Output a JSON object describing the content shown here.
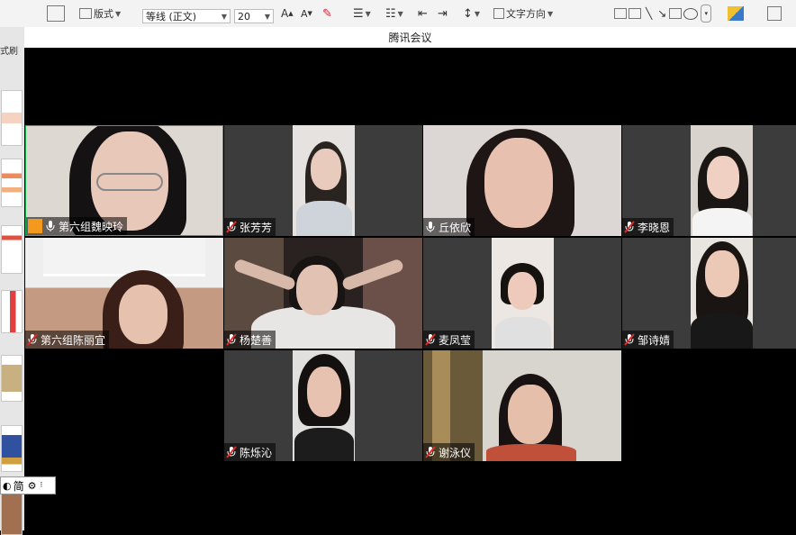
{
  "ribbon": {
    "layout_label": "版式",
    "font_name": "等线 (正文)",
    "font_size": "20",
    "text_direction": "文字方向",
    "format_painter_fragment": "式刷"
  },
  "meeting": {
    "window_title": "腾讯会议",
    "participants": [
      {
        "name": "第六组魏映玲",
        "mic": "on",
        "host": true,
        "active": true
      },
      {
        "name": "张芳芳",
        "mic": "muted"
      },
      {
        "name": "丘依欣",
        "mic": "on"
      },
      {
        "name": "李晓恩",
        "mic": "muted"
      },
      {
        "name": "第六组陈丽宜",
        "mic": "muted"
      },
      {
        "name": "杨楚善",
        "mic": "muted"
      },
      {
        "name": "麦凤莹",
        "mic": "muted"
      },
      {
        "name": "邹诗婧",
        "mic": "muted"
      },
      {
        "name": "陈烁沁",
        "mic": "muted"
      },
      {
        "name": "谢泳仪",
        "mic": "muted"
      }
    ]
  },
  "ime": {
    "mode_label": "简"
  },
  "colors": {
    "active_border": "#19b955",
    "muted_mic": "#e02b2b",
    "host_badge": "#f39a1e"
  }
}
